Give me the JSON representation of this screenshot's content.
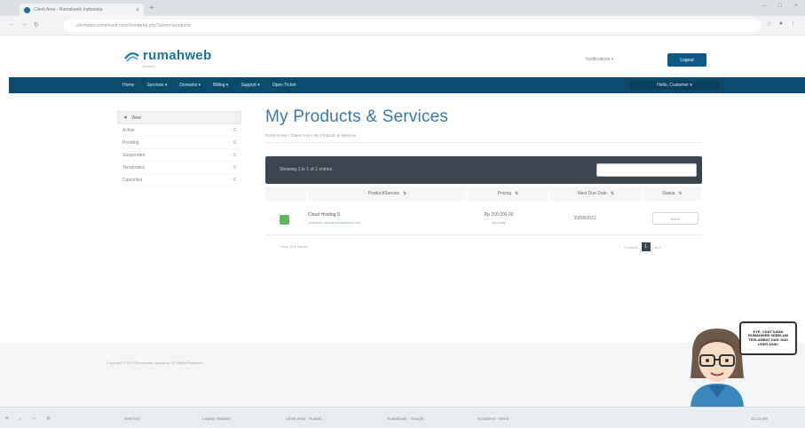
{
  "browser": {
    "tab_title": "Client Area - Rumahweb Indonesia",
    "tab_close": "×",
    "new_tab": "+",
    "url": "clientarea.rumahweb.com/clientarea.php?action=products",
    "nav": [
      "←",
      "→",
      "↻"
    ],
    "tools": [
      "☆",
      "●",
      "⋮"
    ],
    "window_controls": [
      "–",
      "□",
      "×"
    ]
  },
  "header": {
    "logo": "rumahweb",
    "tagline": "indonesia",
    "notifications": "Notifications ▾",
    "logout": "Logout"
  },
  "menu": {
    "items": [
      "Home",
      "Services ▾",
      "Domains ▾",
      "Billing ▾",
      "Support ▾",
      "Open Ticket"
    ],
    "hello": "Hello, Customer ▾"
  },
  "sidebar": {
    "filter_label": "View",
    "items": [
      {
        "label": "Active",
        "count": "0"
      },
      {
        "label": "Pending",
        "count": "0"
      },
      {
        "label": "Suspended",
        "count": "0"
      },
      {
        "label": "Terminated",
        "count": "0"
      },
      {
        "label": "Cancelled",
        "count": "0"
      }
    ]
  },
  "page": {
    "title": "My Products & Services",
    "breadcrumb": "Portal Home / Client Area / My Products & Services"
  },
  "table": {
    "showing": "Showing 1 to 1 of 1 entries",
    "columns": [
      "Product/Service",
      "Pricing",
      "Next Due Date",
      "Status"
    ],
    "rows": [
      {
        "product": "Cloud Hosting S",
        "domain": "customer-domain-rumahweb.com",
        "price": "Rp 200.000,00",
        "cycle": "Annually",
        "due": "30/08/2021",
        "status": "Active"
      }
    ],
    "show_entries": "Show 10 ▾ entries",
    "pager": {
      "prev": "Previous",
      "current": "1",
      "next": "Next"
    }
  },
  "footer": {
    "copyright": "Copyright © 2021 Rumahweb Indonesia. All Rights Reserved."
  },
  "taskbar": {
    "items": [
      "New Doc",
      "Legacy Website",
      "Client Area - Rumah...",
      "Rumahweb - Google...",
      "Document - Word"
    ],
    "clock": "10:15 AM"
  },
  "mascot": {
    "bubble": "EYE, CHAT SAMA RUMAHWEB SEBELUM TERLAMBAT DAN JADI USER ASIK!"
  },
  "colors": {
    "brand": "#1a74a4",
    "nav": "#0c4a6e",
    "accent": "#0c5a86",
    "table_header": "#3b4550",
    "active": "#5cb85c"
  }
}
